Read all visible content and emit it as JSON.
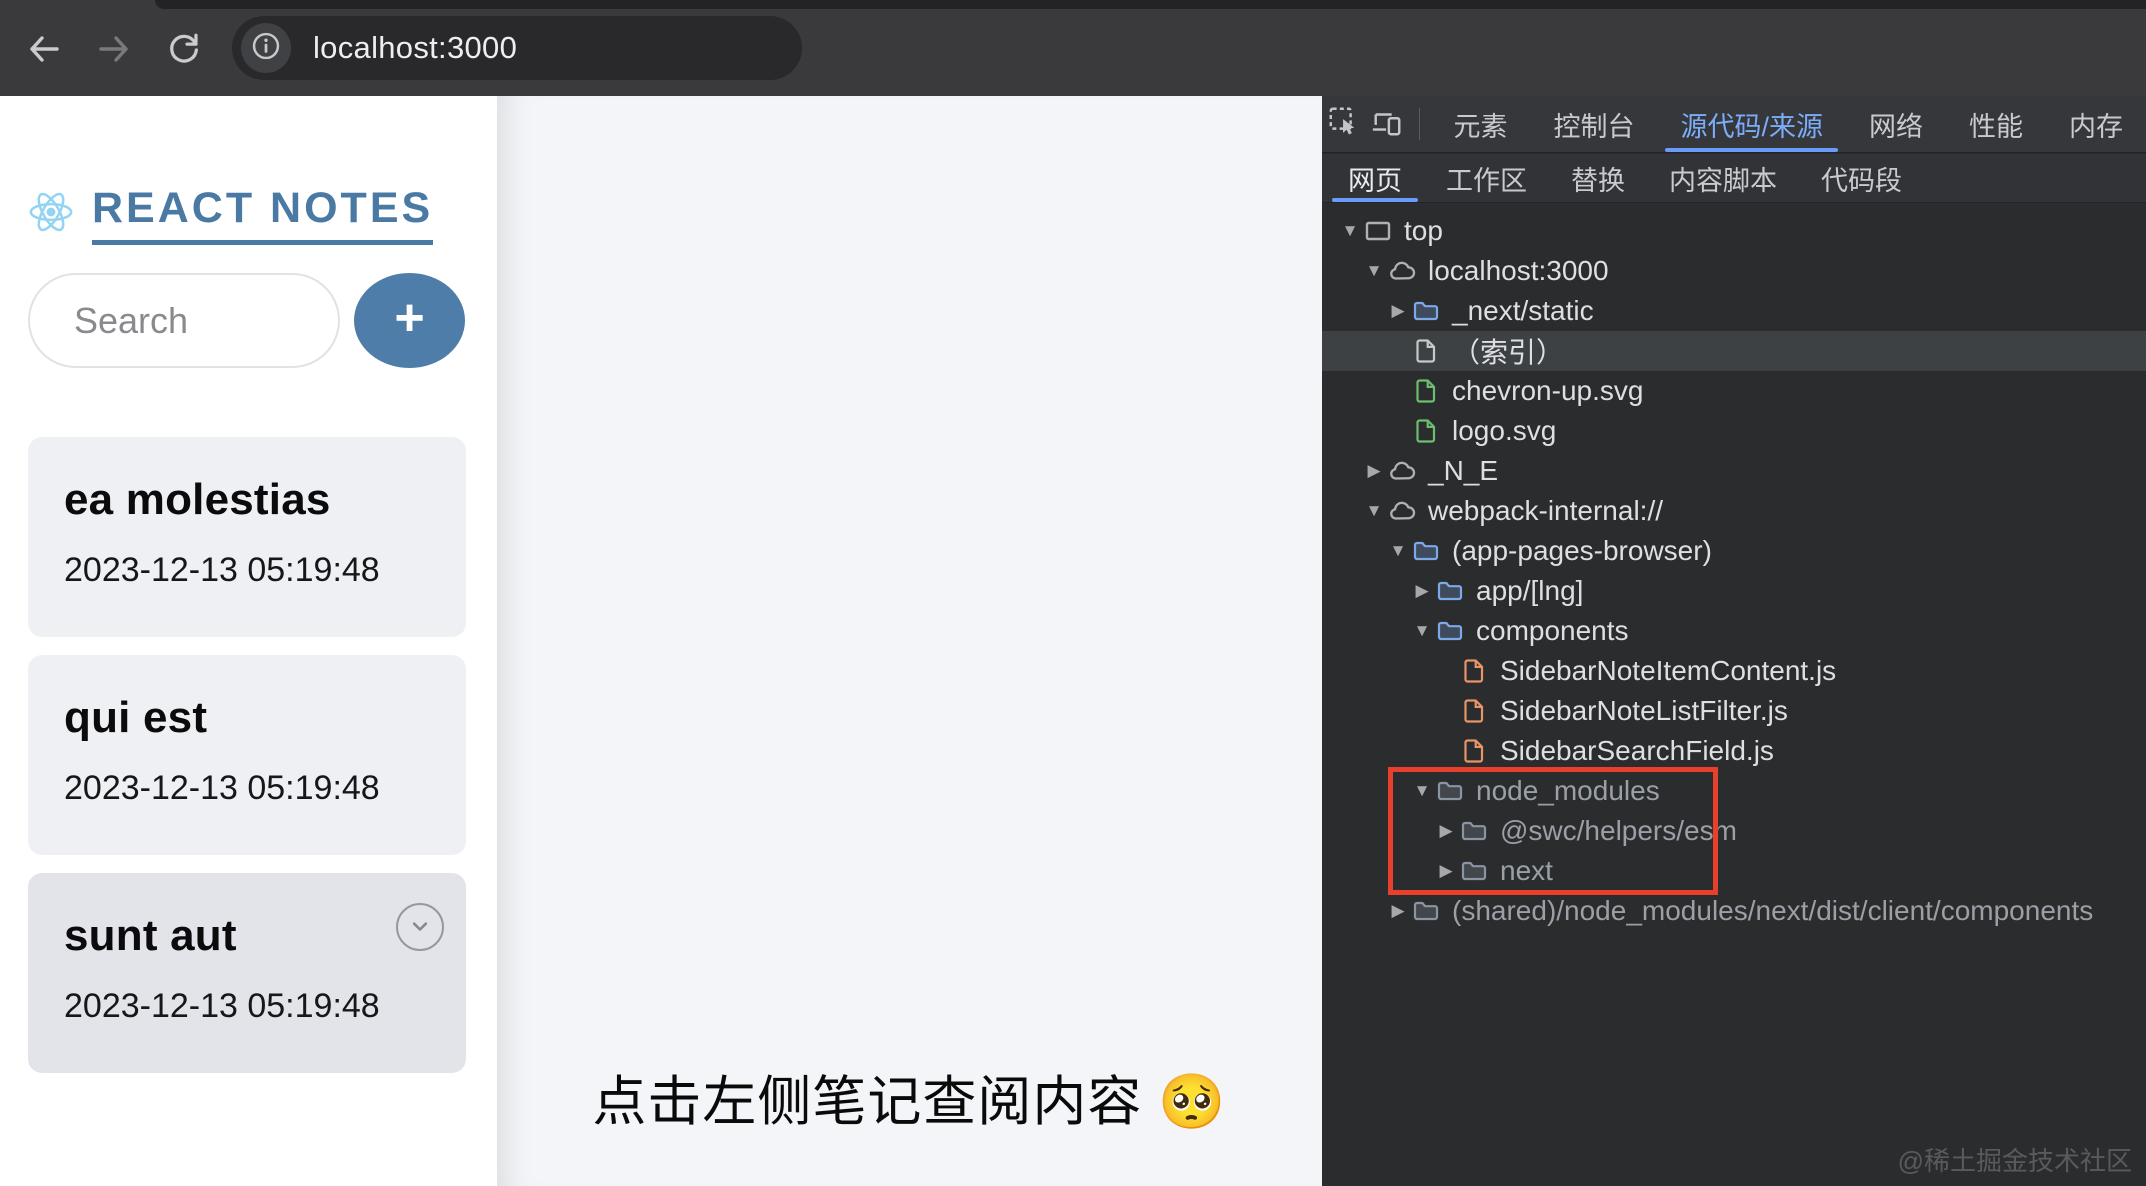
{
  "browser": {
    "url": "localhost:3000",
    "icons": [
      "back-icon",
      "forward-icon",
      "reload-icon",
      "info-icon"
    ]
  },
  "sidebar": {
    "title": "REACT NOTES",
    "logo": "react-atom-icon",
    "search_placeholder": "Search",
    "add_button_label": "+",
    "notes": [
      {
        "title": "ea molestias",
        "timestamp": "2023-12-13 05:19:48"
      },
      {
        "title": "qui est",
        "timestamp": "2023-12-13 05:19:48"
      },
      {
        "title": "sunt aut",
        "timestamp": "2023-12-13 05:19:48"
      }
    ]
  },
  "main": {
    "hint": "点击左侧笔记查阅内容 🥺"
  },
  "devtools": {
    "main_tabs": [
      {
        "label": "元素",
        "selected": false
      },
      {
        "label": "控制台",
        "selected": false
      },
      {
        "label": "源代码/来源",
        "selected": true
      },
      {
        "label": "网络",
        "selected": false
      },
      {
        "label": "性能",
        "selected": false
      },
      {
        "label": "内存",
        "selected": false
      }
    ],
    "sub_tabs": [
      {
        "label": "网页",
        "selected": true
      },
      {
        "label": "工作区",
        "selected": false
      },
      {
        "label": "替换",
        "selected": false
      },
      {
        "label": "内容脚本",
        "selected": false
      },
      {
        "label": "代码段",
        "selected": false
      }
    ],
    "tree": [
      {
        "label": "top",
        "icon": "frame-icon",
        "level": 0,
        "arrow": "down",
        "selected": false,
        "dimmed": false
      },
      {
        "label": "localhost:3000",
        "icon": "cloud-icon",
        "level": 1,
        "arrow": "down",
        "selected": false,
        "dimmed": false
      },
      {
        "label": "_next/static",
        "icon": "folder-icon",
        "level": 2,
        "arrow": "right",
        "selected": false,
        "dimmed": false
      },
      {
        "label": "（索引）",
        "icon": "file-icon",
        "file_color": "gray",
        "level": 2,
        "arrow": "none",
        "selected": true,
        "dimmed": false
      },
      {
        "label": "chevron-up.svg",
        "icon": "file-icon",
        "file_color": "green",
        "level": 2,
        "arrow": "none",
        "selected": false,
        "dimmed": false
      },
      {
        "label": "logo.svg",
        "icon": "file-icon",
        "file_color": "green",
        "level": 2,
        "arrow": "none",
        "selected": false,
        "dimmed": false
      },
      {
        "label": "_N_E",
        "icon": "cloud-icon",
        "level": 1,
        "arrow": "right",
        "selected": false,
        "dimmed": false
      },
      {
        "label": "webpack-internal://",
        "icon": "cloud-icon",
        "level": 1,
        "arrow": "down",
        "selected": false,
        "dimmed": false
      },
      {
        "label": "(app-pages-browser)",
        "icon": "folder-icon",
        "level": 2,
        "arrow": "down",
        "selected": false,
        "dimmed": false
      },
      {
        "label": "app/[lng]",
        "icon": "folder-icon",
        "level": 3,
        "arrow": "right",
        "selected": false,
        "dimmed": false
      },
      {
        "label": "components",
        "icon": "folder-icon",
        "level": 3,
        "arrow": "down",
        "selected": false,
        "dimmed": false
      },
      {
        "label": "SidebarNoteItemContent.js",
        "icon": "file-icon",
        "file_color": "orange",
        "level": 4,
        "arrow": "none",
        "selected": false,
        "dimmed": false
      },
      {
        "label": "SidebarNoteListFilter.js",
        "icon": "file-icon",
        "file_color": "orange",
        "level": 4,
        "arrow": "none",
        "selected": false,
        "dimmed": false
      },
      {
        "label": "SidebarSearchField.js",
        "icon": "file-icon",
        "file_color": "orange",
        "level": 4,
        "arrow": "none",
        "selected": false,
        "dimmed": false
      },
      {
        "label": "node_modules",
        "icon": "folder-icon",
        "level": 3,
        "arrow": "down",
        "selected": false,
        "dimmed": true
      },
      {
        "label": "@swc/helpers/esm",
        "icon": "folder-icon",
        "level": 4,
        "arrow": "right",
        "selected": false,
        "dimmed": true
      },
      {
        "label": "next",
        "icon": "folder-icon",
        "level": 4,
        "arrow": "right",
        "selected": false,
        "dimmed": true
      },
      {
        "label": "(shared)/node_modules/next/dist/client/components",
        "icon": "folder-icon",
        "level": 2,
        "arrow": "right",
        "selected": false,
        "dimmed": true
      }
    ],
    "annotation": "red-highlight-box",
    "watermark": "@稀土掘金技术社区"
  },
  "colors": {
    "accent_blue": "#4a7aa3",
    "devtools_tab_selected": "#7cacf8",
    "red_highlight": "#e8402d",
    "folder_blue": "#7ca9e8",
    "file_green": "#6cbf6c",
    "file_orange": "#e89468",
    "file_gray": "#c6c9c7"
  }
}
